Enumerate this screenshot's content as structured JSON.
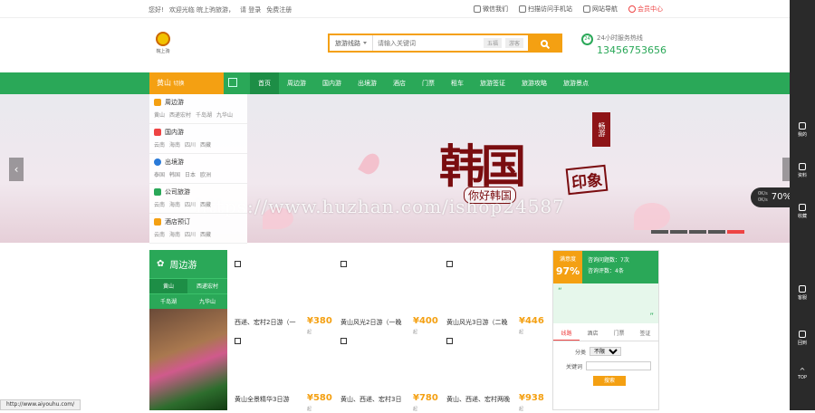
{
  "topbar": {
    "greeting": "您好!",
    "welcome": "欢迎光临 皖上驹旅游，",
    "login": "请 登录",
    "register": "免费注册",
    "links": [
      "微信我们",
      "扫描访问手机站",
      "网站导航",
      "会员中心"
    ]
  },
  "logo": {
    "text": "皖上驹"
  },
  "search": {
    "category": "旅游线路",
    "placeholder": "请输入关键词",
    "tags": [
      "五福",
      "游客"
    ]
  },
  "hotline": {
    "label": "24小时服务热线",
    "number": "13456753656"
  },
  "city": {
    "name": "黄山",
    "hint": "切换"
  },
  "nav": {
    "items": [
      "首页",
      "周边游",
      "国内游",
      "出境游",
      "酒店",
      "门票",
      "租车",
      "旅游签证",
      "旅游攻略",
      "旅游景点"
    ]
  },
  "categories": [
    {
      "title": "周边游",
      "subs": [
        "黄山",
        "西递宏村",
        "千岛湖",
        "九华山"
      ],
      "color": "#f4a012"
    },
    {
      "title": "国内游",
      "subs": [
        "云南",
        "海南",
        "四川",
        "西藏"
      ],
      "color": "#e44"
    },
    {
      "title": "出境游",
      "subs": [
        "泰国",
        "韩国",
        "日本",
        "欧洲"
      ],
      "color": "#2a7ad8"
    },
    {
      "title": "公司旅游",
      "subs": [
        "云南",
        "海南",
        "四川",
        "西藏"
      ],
      "color": "#2aa858"
    },
    {
      "title": "酒店预订",
      "subs": [
        "云南",
        "海南",
        "四川",
        "西藏"
      ],
      "color": "#f4a012"
    }
  ],
  "banner": {
    "title": "韩国",
    "hello": "你好韩国",
    "impression": "印象",
    "tag": "畅游",
    "watermark": "https://www.huzhan.com/ishop24587",
    "speed": "70%",
    "speed_rows": [
      "0K/s",
      "0K/s"
    ]
  },
  "section": {
    "title": "周边游",
    "tabs": [
      "黄山",
      "西递宏村",
      "千岛湖",
      "九华山"
    ]
  },
  "products": [
    {
      "name": "西递、宏村2日游（一",
      "price": "¥380",
      "unit": "起"
    },
    {
      "name": "黄山风光2日游（一晚",
      "price": "¥400",
      "unit": "起"
    },
    {
      "name": "黄山风光3日游（二晚",
      "price": "¥446",
      "unit": "起"
    },
    {
      "name": "黄山全景精华3日游",
      "price": "¥580",
      "unit": "起"
    },
    {
      "name": "黄山、西递、宏村3日",
      "price": "¥780",
      "unit": "起"
    },
    {
      "name": "黄山、西递、宏村两晚",
      "price": "¥938",
      "unit": "起"
    }
  ],
  "rpanel": {
    "sat_label": "满意度",
    "sat_value": "97%",
    "stat1": "咨询问题数：7次",
    "stat2": "咨询评数：4条",
    "tabs": [
      "线路",
      "酒店",
      "门票",
      "签证"
    ],
    "form_type_label": "分类",
    "form_type_value": "不限",
    "form_kw_label": "关键词",
    "search_btn": "搜索"
  },
  "sidebar": [
    "我的",
    "资料",
    "收藏",
    "客服",
    "回到",
    "TOP"
  ],
  "status_url": "http://www.aiyouhu.com/"
}
